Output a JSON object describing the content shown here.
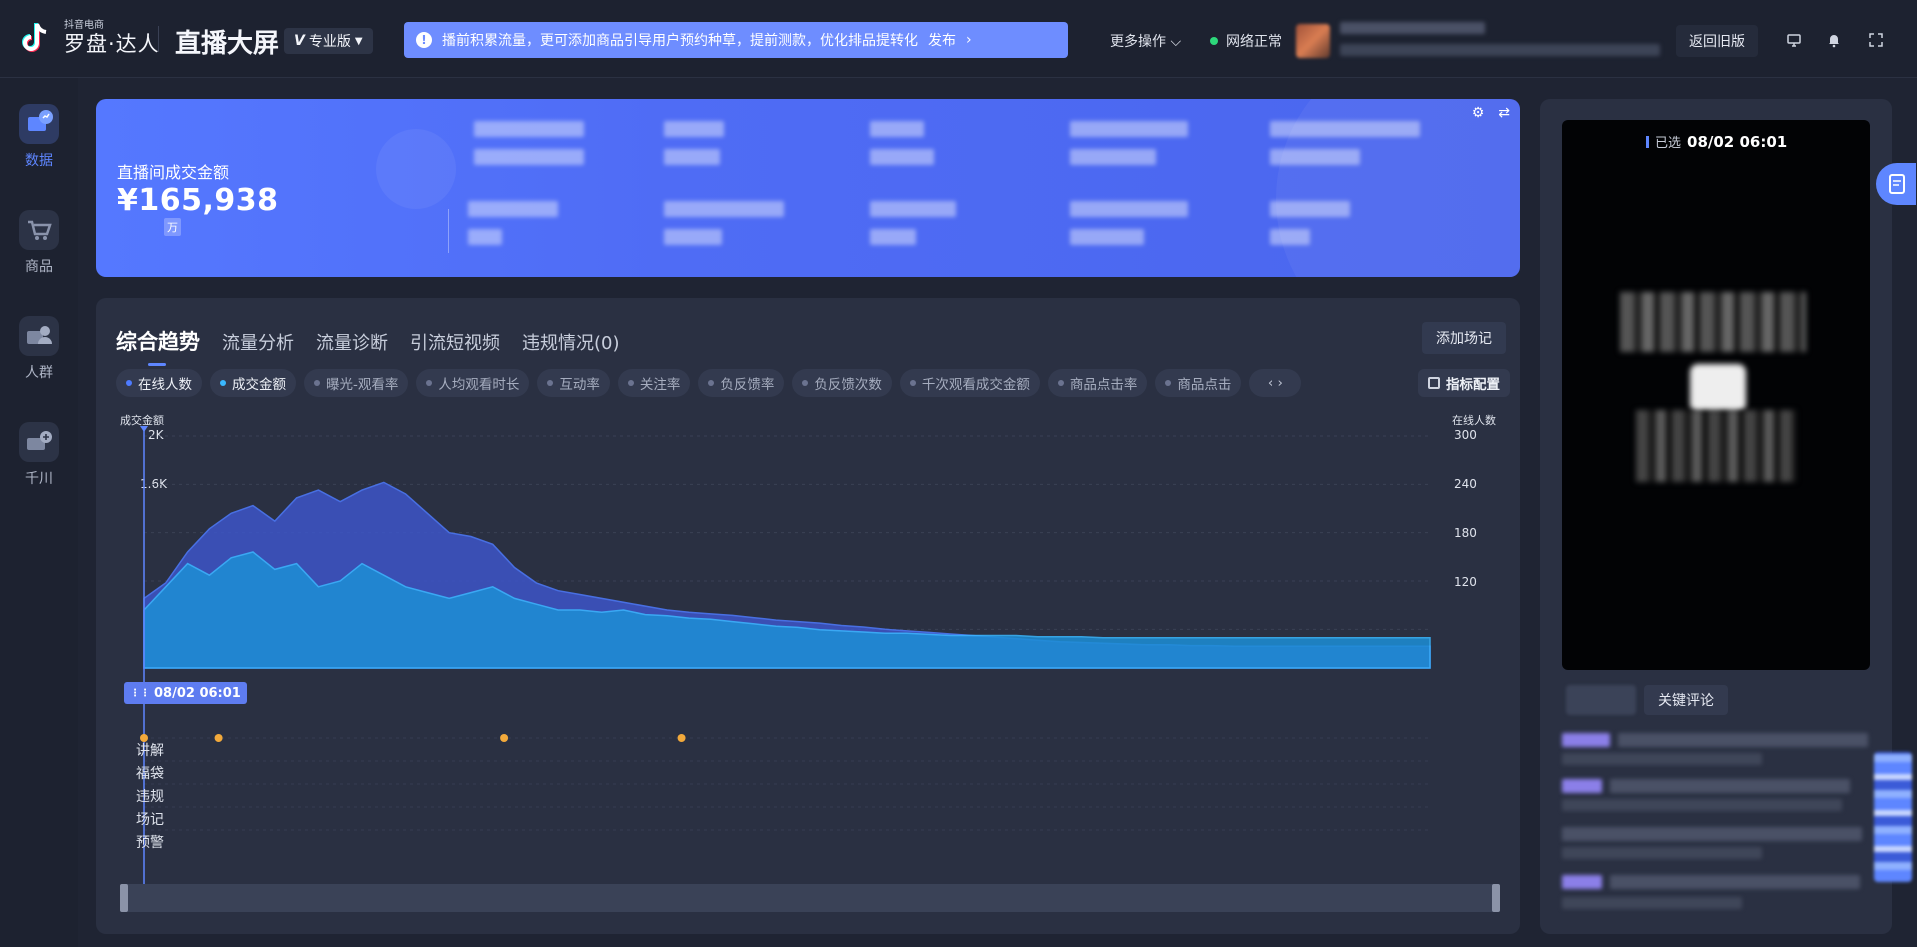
{
  "app": {
    "brand_top": "抖音电商",
    "brand": "罗盘·达人",
    "title": "直播大屏",
    "edition": "专业版"
  },
  "notice": {
    "text": "播前积累流量，更可添加商品引导用户预约种草，提前测款，优化排品提转化",
    "action": "发布",
    "arrow": "›"
  },
  "topbar": {
    "more_ops": "更多操作 ⌵",
    "network": "网络正常",
    "back_old": "返回旧版",
    "icons": [
      "monitor-icon",
      "bell-icon",
      "fullscreen-icon"
    ]
  },
  "sidebar": {
    "items": [
      {
        "label": "数据",
        "icon": "data-chart-icon",
        "active": true
      },
      {
        "label": "商品",
        "icon": "cart-icon",
        "active": false
      },
      {
        "label": "人群",
        "icon": "people-icon",
        "active": false
      },
      {
        "label": "千川",
        "icon": "ad-icon",
        "active": false
      }
    ]
  },
  "kpi": {
    "label": "直播间成交金额",
    "value": "¥165,938",
    "unit": "万"
  },
  "trend": {
    "tabs": [
      "综合趋势",
      "流量分析",
      "流量诊断",
      "引流短视频",
      "违规情况(0)"
    ],
    "add_scene": "添加场记",
    "metrics": [
      "在线人数",
      "成交金额",
      "曝光-观看率",
      "人均观看时长",
      "互动率",
      "关注率",
      "负反馈率",
      "负反馈次数",
      "千次观看成交金额",
      "商品点击率",
      "商品点击"
    ],
    "metric_config": "指标配置",
    "nav": "‹ ›",
    "time_badge": "08/02 06:01",
    "event_rows": [
      "讲解",
      "福袋",
      "违规",
      "场记",
      "预警"
    ]
  },
  "chart_data": {
    "type": "area",
    "left_axis_title": "成交金额",
    "right_axis_title": "在线人数",
    "left_ticks": [
      "2K",
      "1.6K"
    ],
    "right_ticks": [
      "300",
      "240",
      "180",
      "120"
    ],
    "ylim_left": [
      0,
      2000
    ],
    "ylim_right": [
      0,
      300
    ],
    "series": [
      {
        "name": "在线人数",
        "color": "#4e7bff",
        "values": [
          90,
          110,
          150,
          180,
          200,
          210,
          190,
          220,
          230,
          215,
          230,
          240,
          225,
          200,
          175,
          170,
          160,
          130,
          110,
          100,
          95,
          90,
          85,
          80,
          75,
          72,
          70,
          68,
          65,
          62,
          60,
          58,
          55,
          53,
          50,
          48,
          46,
          44,
          42,
          40,
          38,
          36,
          34,
          33,
          32,
          31,
          30,
          30,
          29,
          29,
          28,
          28,
          28,
          28,
          28,
          28,
          28,
          28,
          28,
          28
        ]
      },
      {
        "name": "成交金额",
        "color": "#3ab8ff",
        "values": [
          500,
          700,
          900,
          800,
          950,
          1000,
          850,
          900,
          700,
          750,
          900,
          800,
          700,
          650,
          600,
          650,
          700,
          600,
          550,
          500,
          500,
          480,
          500,
          460,
          450,
          430,
          420,
          400,
          380,
          360,
          350,
          330,
          320,
          310,
          300,
          300,
          290,
          280,
          280,
          280,
          280,
          270,
          270,
          270,
          260,
          260,
          260,
          260,
          260,
          260,
          260,
          260,
          260,
          260,
          260,
          260,
          260,
          260,
          260,
          260
        ]
      }
    ],
    "events": {
      "讲解": [
        0.0,
        0.058,
        0.28,
        0.418
      ]
    },
    "grid": true,
    "legend": "top-left"
  },
  "live": {
    "selected_label": "已选",
    "selected_time": "08/02 06:01",
    "comment_tab": "关键评论"
  }
}
